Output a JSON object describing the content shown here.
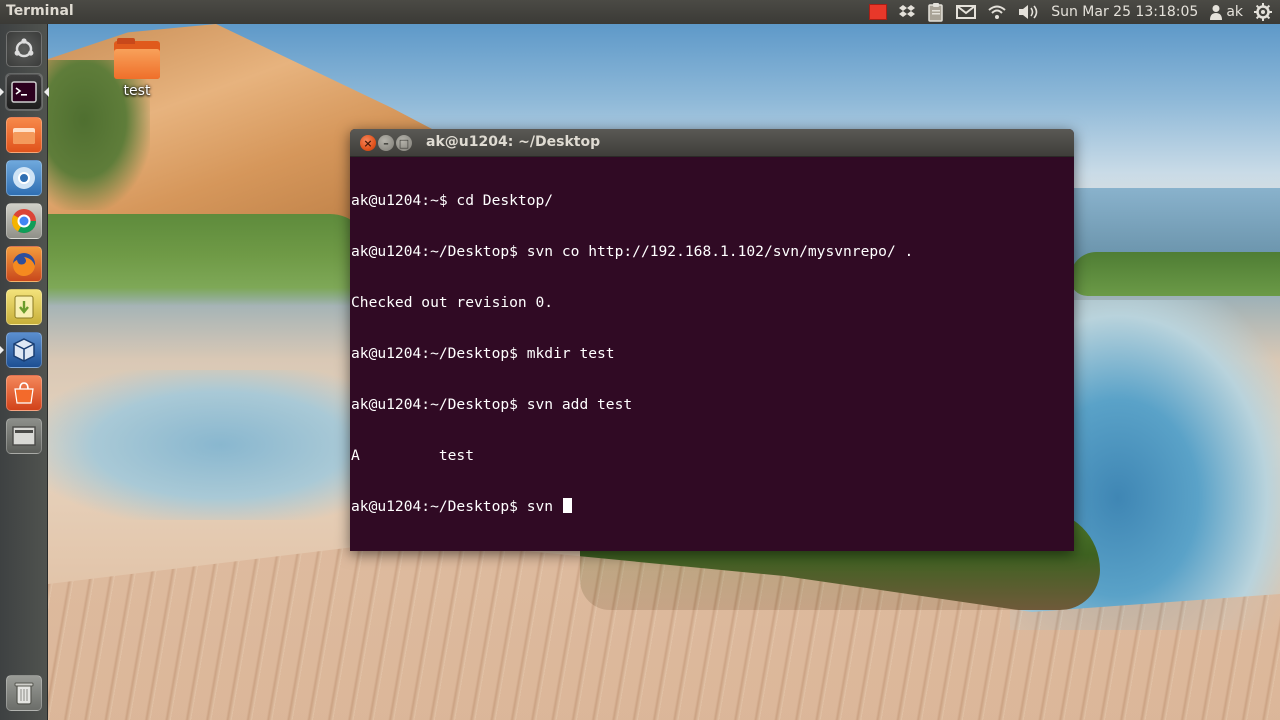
{
  "top_panel": {
    "app_title": "Terminal",
    "clock": "Sun Mar 25 13:18:05",
    "user": "ak",
    "indicators": [
      "record-icon",
      "dropbox-icon",
      "clipboard-icon",
      "mail-icon",
      "wifi-icon",
      "volume-icon",
      "clock",
      "user-icon",
      "gear-icon"
    ],
    "record_color": "#e8382a"
  },
  "launcher": {
    "items": [
      {
        "name": "dash-home",
        "icon": "ubuntu-logo-icon"
      },
      {
        "name": "terminal",
        "icon": "terminal-icon"
      },
      {
        "name": "files",
        "icon": "files-icon"
      },
      {
        "name": "chromium",
        "icon": "chromium-icon"
      },
      {
        "name": "chrome",
        "icon": "chrome-icon"
      },
      {
        "name": "firefox",
        "icon": "firefox-icon"
      },
      {
        "name": "archive",
        "icon": "archive-icon"
      },
      {
        "name": "virtualbox",
        "icon": "virtualbox-icon"
      },
      {
        "name": "software-center",
        "icon": "software-center-icon"
      },
      {
        "name": "workspace-switcher",
        "icon": "workspace-icon"
      },
      {
        "name": "trash",
        "icon": "trash-icon"
      }
    ]
  },
  "desktop": {
    "folder_label": "test",
    "folder_icon": "folder-icon",
    "folder_color": "#ef6f2a"
  },
  "terminal": {
    "title": "ak@u1204: ~/Desktop",
    "background": "#300a24",
    "lines": [
      "ak@u1204:~$ cd Desktop/",
      "ak@u1204:~/Desktop$ svn co http://192.168.1.102/svn/mysvnrepo/ .",
      "Checked out revision 0.",
      "ak@u1204:~/Desktop$ mkdir test",
      "ak@u1204:~/Desktop$ svn add test",
      "A         test",
      "ak@u1204:~/Desktop$ svn "
    ]
  }
}
